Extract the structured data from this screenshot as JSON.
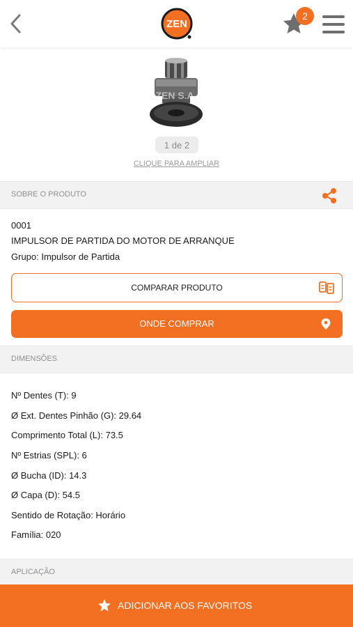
{
  "header": {
    "logo_text": "ZEN",
    "favorites_count": "2"
  },
  "product_image": {
    "watermark": "ZEN S.A.",
    "pager": "1 de 2",
    "zoom_link": "CLIQUE PARA AMPLIAR"
  },
  "about": {
    "section_title": "SOBRE O PRODUTO",
    "code": "0001",
    "name": "IMPULSOR DE PARTIDA DO MOTOR DE ARRANQUE",
    "group": "Grupo: Impulsor de Partida"
  },
  "actions": {
    "compare_label": "COMPARAR PRODUTO",
    "buy_label": "ONDE COMPRAR"
  },
  "dimensions": {
    "section_title": "DIMENSÕES",
    "specs": [
      "Nº Dentes (T): 9",
      "Ø Ext. Dentes Pinhão (G): 29.64",
      "Comprimento Total (L): 73.5",
      "Nº Estrias (SPL): 6",
      "Ø Bucha (ID): 14.3",
      "Ø Capa (D): 54.5",
      "Sentido de Rotação: Horário",
      "Família: 020"
    ]
  },
  "application": {
    "section_title": "APLICAÇÃO"
  },
  "footer": {
    "favorite_label": "ADICIONAR AOS FAVORITOS"
  },
  "colors": {
    "accent": "#f36f21",
    "section_bg": "#f2f2f2",
    "muted_text": "#8f8f8f"
  }
}
